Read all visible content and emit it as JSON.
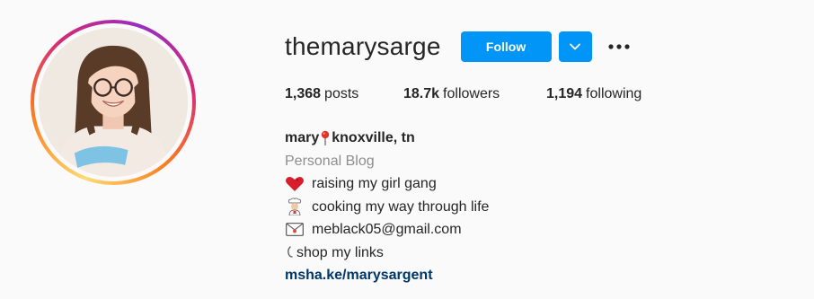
{
  "profile": {
    "username": "themarysarge",
    "follow_label": "Follow"
  },
  "stats": {
    "posts_count": "1,368",
    "posts_label": "posts",
    "followers_count": "18.7k",
    "followers_label": "followers",
    "following_count": "1,194",
    "following_label": "following"
  },
  "bio": {
    "name_part1": "mary",
    "name_part2": "knoxville, tn",
    "category": "Personal Blog",
    "lines": [
      {
        "icon": "heart-icon",
        "text": "raising my girl gang"
      },
      {
        "icon": "chef-icon",
        "text": "cooking my way through life"
      },
      {
        "icon": "envelope-icon",
        "text": "meblack05@gmail.com"
      },
      {
        "icon": "hook-icon",
        "text": "shop my links"
      }
    ],
    "link": "msha.ke/marysargent"
  },
  "colors": {
    "accent": "#0095f6",
    "link": "#00376b",
    "secondary_text": "#8e8e8e"
  }
}
